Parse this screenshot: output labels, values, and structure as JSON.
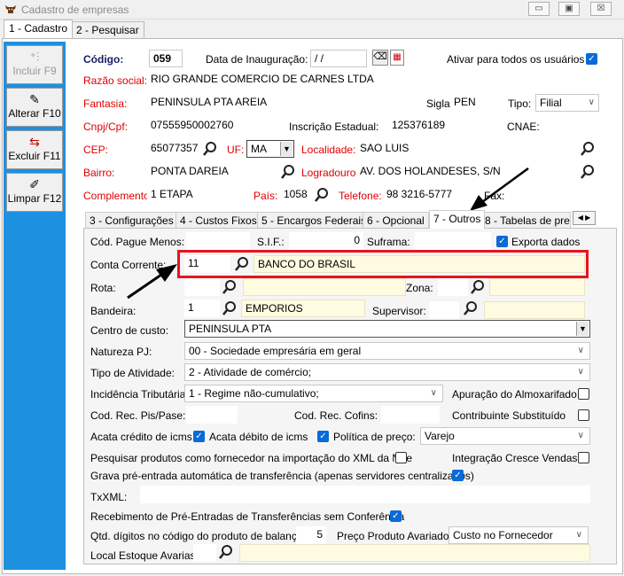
{
  "window": {
    "title": "Cadastro de empresas",
    "btn_min": "▭",
    "btn_max": "▣",
    "btn_close": "☒"
  },
  "top_tabs": [
    "1 - Cadastro",
    "2 - Pesquisar"
  ],
  "sidebar": [
    {
      "label": "Incluir F9",
      "icon": "plus-icon"
    },
    {
      "label": "Alterar F10",
      "icon": "edit-icon"
    },
    {
      "label": "Excluir F11",
      "icon": "delete-icon"
    },
    {
      "label": "Limpar F12",
      "icon": "clear-icon"
    }
  ],
  "header": {
    "codigo_label": "Código:",
    "codigo": "059",
    "data_inauguracao_label": "Data de Inauguração:",
    "data_inauguracao": " / /",
    "ativar_label": "Ativar para todos os usuários",
    "ativar_checked": true,
    "razao_label": "Razão social:",
    "razao": "RIO GRANDE COMERCIO DE CARNES LTDA",
    "fantasia_label": "Fantasia:",
    "fantasia": "PENINSULA PTA AREIA",
    "sigla_label": "Sigla:",
    "sigla": "PEN",
    "tipo_label": "Tipo:",
    "tipo": "Filial",
    "cnpj_label": "Cnpj/Cpf:",
    "cnpj": "07555950002760",
    "ie_label": "Inscrição Estadual:",
    "ie": "125376189",
    "cnae_label": "CNAE:",
    "cnae": "",
    "cep_label": "CEP:",
    "cep": "65077357",
    "uf_label": "UF:",
    "uf": "MA",
    "localidade_label": "Localidade:",
    "localidade": "SAO LUIS",
    "bairro_label": "Bairro:",
    "bairro": "PONTA DAREIA",
    "logradouro_label": "Logradouro:",
    "logradouro": "AV. DOS HOLANDESES, S/N",
    "complemento_label": "Complemento:",
    "complemento": "1 ETAPA",
    "pais_label": "País:",
    "pais": "1058",
    "telefone_label": "Telefone:",
    "telefone": "98 3216-5777",
    "fax_label": "Fax:",
    "fax": ""
  },
  "sub_tabs": [
    "3 - Configurações",
    "4 - Custos Fixos",
    "5 - Encargos Federais",
    "6 - Opcional",
    "7 - Outros",
    "8 - Tabelas de pre"
  ],
  "outros": {
    "pague_menos_label": "Cód. Pague Menos:",
    "pague_menos": "",
    "sif_label": "S.I.F.:",
    "sif": "0",
    "suframa_label": "Suframa:",
    "suframa": "",
    "exporta_label": "Exporta dados",
    "exporta_checked": true,
    "conta_label": "Conta Corrente:",
    "conta": "11",
    "conta_desc": "BANCO DO BRASIL",
    "rota_label": "Rota:",
    "rota": "",
    "zona_label": "Zona:",
    "zona": "",
    "bandeira_label": "Bandeira:",
    "bandeira": "1",
    "bandeira_desc": "EMPORIOS",
    "supervisor_label": "Supervisor:",
    "supervisor": "",
    "centro_label": "Centro de custo:",
    "centro": "PENINSULA PTA",
    "natureza_label": "Natureza PJ:",
    "natureza": "00 - Sociedade empresária em geral",
    "atividade_label": "Tipo de Atividade:",
    "atividade": "2 - Atividade de comércio;",
    "incidencia_label": "Incidência Tributária:",
    "incidencia": "1 - Regime não-cumulativo;",
    "apuracao_label": "Apuração do Almoxarifado",
    "pis_label": "Cod. Rec. Pis/Pase:",
    "pis": "",
    "cofins_label": "Cod. Rec. Cofins:",
    "cofins": "",
    "contribuinte_label": "Contribuinte Substituído",
    "acata_credito_label": "Acata crédito de icms",
    "acata_debito_label": "Acata débito de icms",
    "politica_label": "Política de preço:",
    "politica": "Varejo",
    "pesquisar_label": "Pesquisar produtos como fornecedor na importação do XML da NFe",
    "integracao_label": "Integração Cresce Vendas",
    "grava_label": "Grava pré-entrada automática de transferência (apenas servidores centralizados)",
    "txxml_label": "TxXML:",
    "txxml": "",
    "recebimento_label": "Recebimento de Pré-Entradas de Transferências sem Conferência",
    "qtd_label": "Qtd. dígitos no código do produto de balança:",
    "qtd": "5",
    "preco_avariado_label": "Preço Produto Avariado:",
    "preco_avariado": "Custo no Fornecedor",
    "local_avarias_label": "Local Estoque Avarias:",
    "local_avarias": ""
  },
  "colors": {
    "sidebar": "#1e90e0",
    "highlight_box": "#e8141c",
    "required_label": "#e00000",
    "check": "#0a6ad8"
  }
}
